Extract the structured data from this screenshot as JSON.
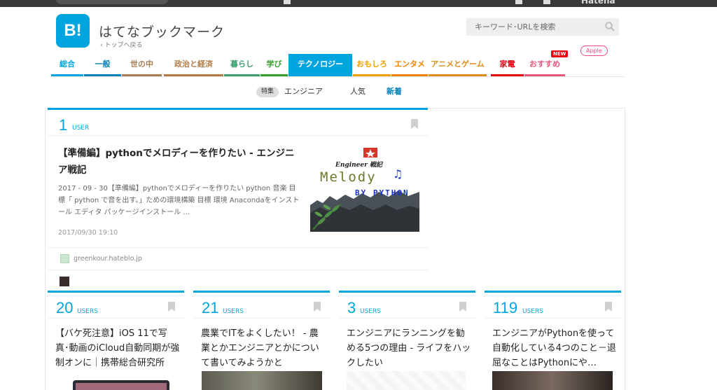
{
  "site": {
    "logo_text": "B!",
    "name": "はてなブックマーク",
    "back_link": "‹ トップへ戻る",
    "brand": "Hatena"
  },
  "search": {
    "placeholder": "キーワード･URLを検索"
  },
  "nav": {
    "tabs": [
      {
        "label": "総合",
        "color": "#00a4de"
      },
      {
        "label": "一般",
        "color": "#0081b8"
      },
      {
        "label": "世の中",
        "color": "#a67c52"
      },
      {
        "label": "政治と経済",
        "color": "#b07d48"
      },
      {
        "label": "暮らし",
        "color": "#3c9e6e"
      },
      {
        "label": "学び",
        "color": "#33a02c"
      },
      {
        "label": "テクノロジー",
        "color": "#00a4de"
      },
      {
        "label": "おもしろ",
        "color": "#f0a000"
      },
      {
        "label": "エンタメ",
        "color": "#f08200"
      },
      {
        "label": "アニメとゲーム",
        "color": "#e08c1a"
      },
      {
        "label": "家電",
        "color": "#e60012"
      },
      {
        "label": "おすすめ",
        "color": "#e8577e"
      }
    ],
    "badge_new": "NEW",
    "badge_apple": "Apple"
  },
  "subnav": {
    "tokushu": "特集",
    "engineer": "エンジニア",
    "popular": "人気",
    "newest": "新着"
  },
  "featured": {
    "count": "1",
    "unit": "USER",
    "title": "【準備編】pythonでメロディーを作りたい - エンジニア戦記",
    "desc": "2017 - 09 - 30【準備編】pythonでメロディーを作りたい python 音楽 目標「 python で音を出す。」ための環境構築 目標 環境 Anacondaをインストール エディタ パッケージインストール ...",
    "date": "2017/09/30 19:10",
    "domain": "greenkour.hateblo.jp",
    "thumb": {
      "top_text": "Engineer 戦記",
      "main_text": "Melody",
      "sub_text": "BY PYTHON"
    }
  },
  "cards": [
    {
      "count": "20",
      "unit": "USERS",
      "title": "【バケ死注意】iOS 11で写真･動画のiCloud自動同期が強制オンに｜携帯総合研究所"
    },
    {
      "count": "21",
      "unit": "USERS",
      "title": "農業でITをよくしたい！ - 農業とかエンジニアとかについて書いてみようかと"
    },
    {
      "count": "3",
      "unit": "USERS",
      "title": "エンジニアにランニングを勧める5つの理由 - ライフをハックしたい"
    },
    {
      "count": "119",
      "unit": "USERS",
      "title": "エンジニアがPythonを使って自動化している4つのこと－退屈なことはPythonにや…"
    }
  ]
}
